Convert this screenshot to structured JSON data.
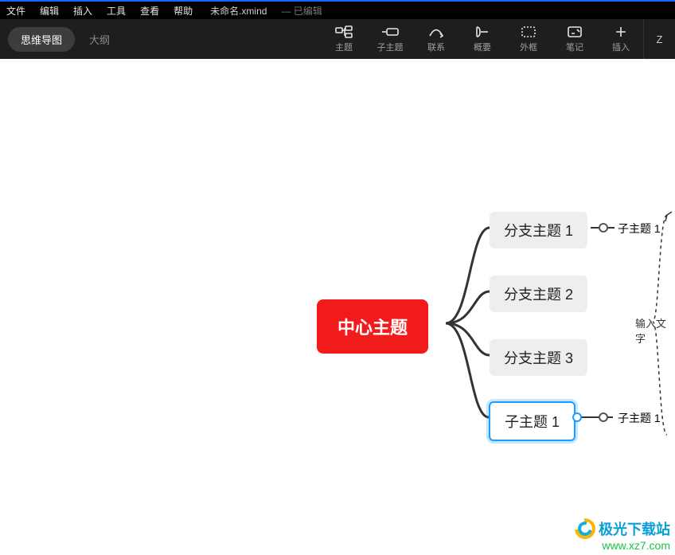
{
  "menubar": {
    "items": [
      "文件",
      "编辑",
      "插入",
      "工具",
      "查看",
      "帮助"
    ],
    "filename": "未命名.xmind",
    "edited": "— 已编辑"
  },
  "viewswitch": {
    "mindmap": "思维导图",
    "outline": "大纲"
  },
  "toolbar": {
    "topic": {
      "label": "主题"
    },
    "subtopic": {
      "label": "子主题"
    },
    "relation": {
      "label": "联系"
    },
    "summary": {
      "label": "概要"
    },
    "boundary": {
      "label": "外框"
    },
    "note": {
      "label": "笔记"
    },
    "insert": {
      "label": "插入"
    },
    "zen": {
      "label": "Z"
    }
  },
  "mindmap": {
    "central": "中心主题",
    "branch1": "分支主题 1",
    "branch2": "分支主题 2",
    "branch3": "分支主题 3",
    "branch4": "子主题 1",
    "leaf1": "子主题 1",
    "leaf2": "子主题 1",
    "hint": "输入文字"
  },
  "watermark": {
    "name": "极光下载站",
    "url": "www.xz7.com"
  }
}
